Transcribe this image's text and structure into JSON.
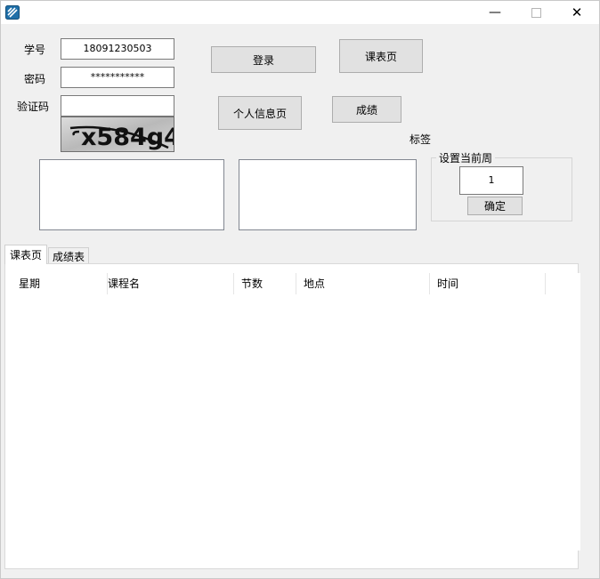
{
  "window": {
    "min_label": "—",
    "close_label": "✕"
  },
  "form": {
    "student_id_label": "学号",
    "student_id_value": "18091230503",
    "password_label": "密码",
    "password_value": "***********",
    "captcha_label": "验证码",
    "captcha_value": "",
    "captcha_image_text": "x584g4"
  },
  "buttons": {
    "login": "登录",
    "timetable": "课表页",
    "personal_info": "个人信息页",
    "grades": "成绩"
  },
  "label_tag": "标签",
  "current_week": {
    "group_title": "设置当前周",
    "value": "1",
    "confirm": "确定"
  },
  "tabs": [
    {
      "label": "课表页",
      "active": true
    },
    {
      "label": "成绩表",
      "active": false
    }
  ],
  "table": {
    "columns": [
      "星期",
      "课程名",
      "节数",
      "地点",
      "时间"
    ],
    "rows": []
  }
}
